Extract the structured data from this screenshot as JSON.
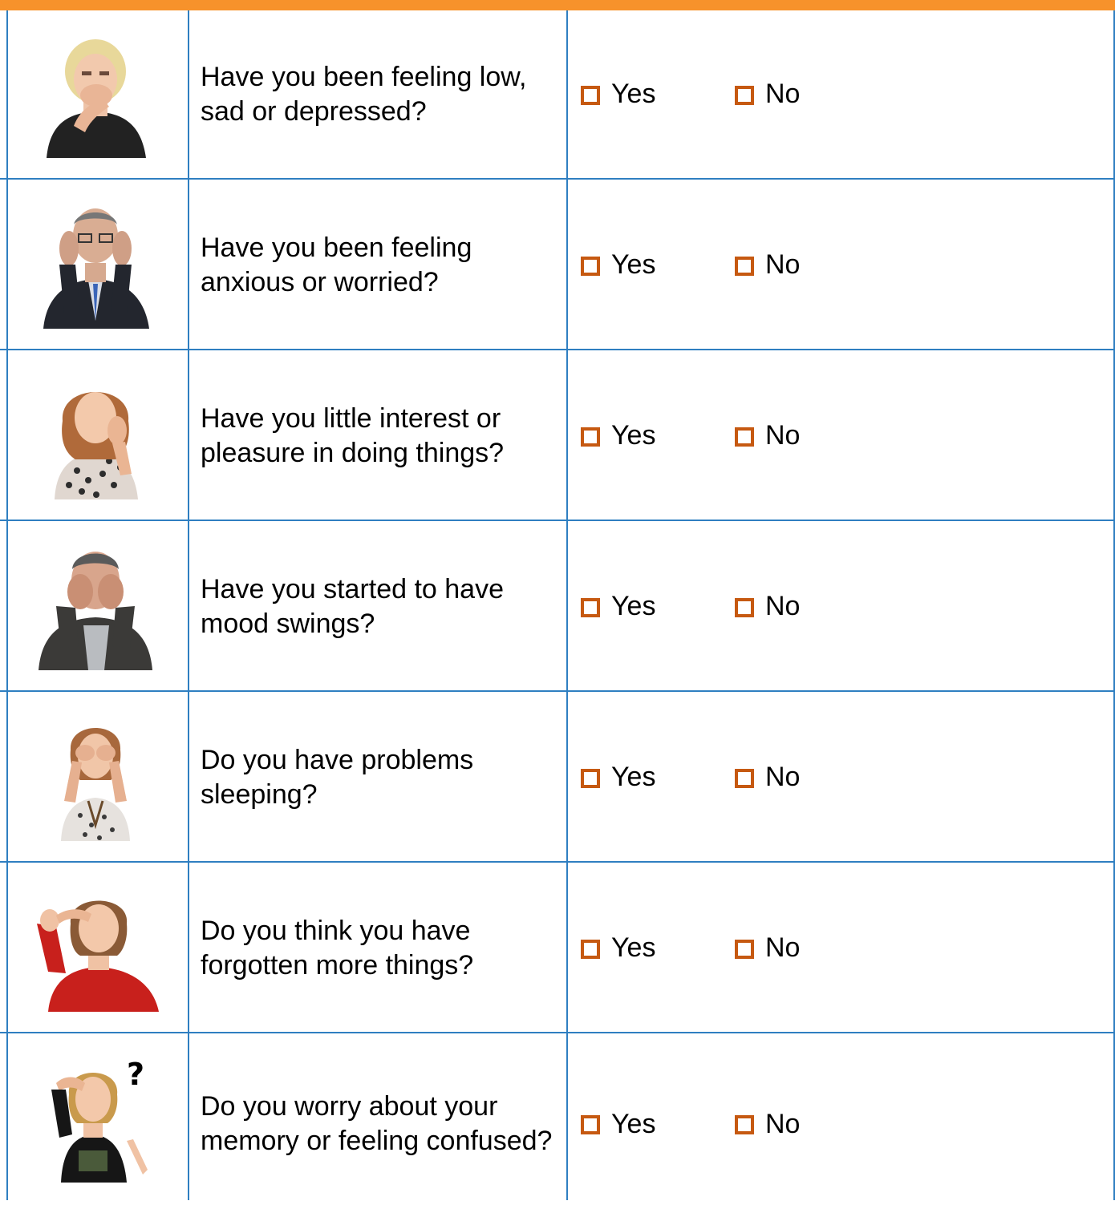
{
  "colors": {
    "header_bar": "#f7922b",
    "grid_lines": "#2f7fc1",
    "checkbox": "#c65911"
  },
  "questions": [
    {
      "text": "Have you been feeling low, sad or depressed?",
      "image": "person-hand-over-mouth",
      "yes_label": "Yes",
      "no_label": "No"
    },
    {
      "text": "Have you been feeling anxious or worried?",
      "image": "man-hands-on-head",
      "yes_label": "Yes",
      "no_label": "No"
    },
    {
      "text": "Have you little interest or pleasure in doing things?",
      "image": "woman-hand-on-cheek",
      "yes_label": "Yes",
      "no_label": "No"
    },
    {
      "text": "Have you started to have mood swings?",
      "image": "man-hands-over-face",
      "yes_label": "Yes",
      "no_label": "No"
    },
    {
      "text": "Do you have problems sleeping?",
      "image": "woman-rubbing-eyes",
      "yes_label": "Yes",
      "no_label": "No"
    },
    {
      "text": "Do you think you have forgotten more things?",
      "image": "woman-hand-on-forehead",
      "yes_label": "Yes",
      "no_label": "No"
    },
    {
      "text": "Do you worry about your memory or feeling confused?",
      "image": "person-confused-question-mark",
      "yes_label": "Yes",
      "no_label": "No",
      "glyph": "?"
    }
  ]
}
